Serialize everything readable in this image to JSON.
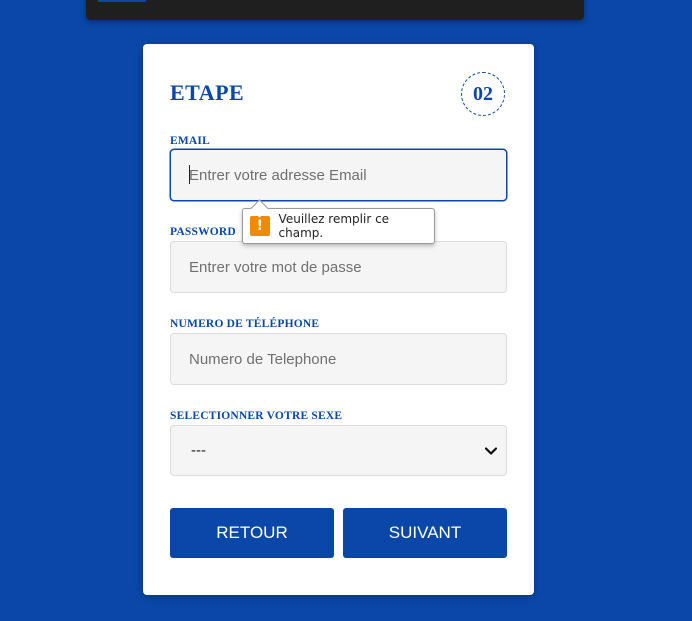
{
  "colors": {
    "background": "#0a47a8",
    "card": "#ffffff",
    "accent": "#0a47a8",
    "input_bg": "#f5f5f5",
    "warning": "#f08a00",
    "header_bar": "#1f1f1f"
  },
  "form": {
    "title": "ETAPE",
    "step_number": "02",
    "email": {
      "label": "EMAIL",
      "placeholder": "Entrer votre adresse Email",
      "value": ""
    },
    "password": {
      "label": "PASSWORD",
      "placeholder": "Entrer votre mot de passe",
      "value": ""
    },
    "phone": {
      "label": "NUMERO DE TÉLÉPHONE",
      "placeholder": "Numero de Telephone",
      "value": ""
    },
    "gender": {
      "label": "SELECTIONNER VOTRE SEXE",
      "selected": "---",
      "icon": "chevron-down-icon"
    },
    "buttons": {
      "back_label": "RETOUR",
      "next_label": "SUIVANT"
    }
  },
  "validation_tooltip": {
    "icon": "warning-icon",
    "icon_glyph": "!",
    "message": "Veuillez remplir ce champ."
  }
}
